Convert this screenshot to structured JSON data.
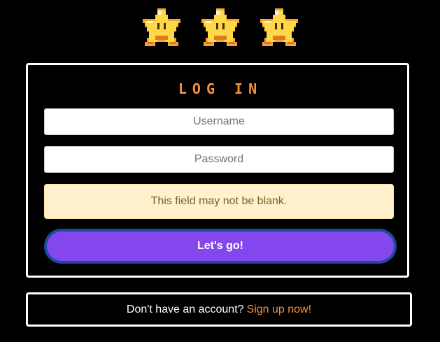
{
  "colors": {
    "background": "#000000",
    "title": "#f5923e",
    "button_bg": "#8447ed",
    "button_border": "#1f4a9b",
    "alert_bg": "#fff1cc",
    "alert_text": "#74622b",
    "link": "#f5923e",
    "star_fill": "#ffd84a"
  },
  "header": {
    "icons": [
      "star-icon",
      "star-icon",
      "star-icon"
    ]
  },
  "login": {
    "title": "LOG IN",
    "username_placeholder": "Username",
    "password_placeholder": "Password",
    "error_message": "This field may not be blank.",
    "submit_label": "Let's go!"
  },
  "signup": {
    "prompt": "Don't have an account?",
    "link_label": "Sign up now!"
  }
}
